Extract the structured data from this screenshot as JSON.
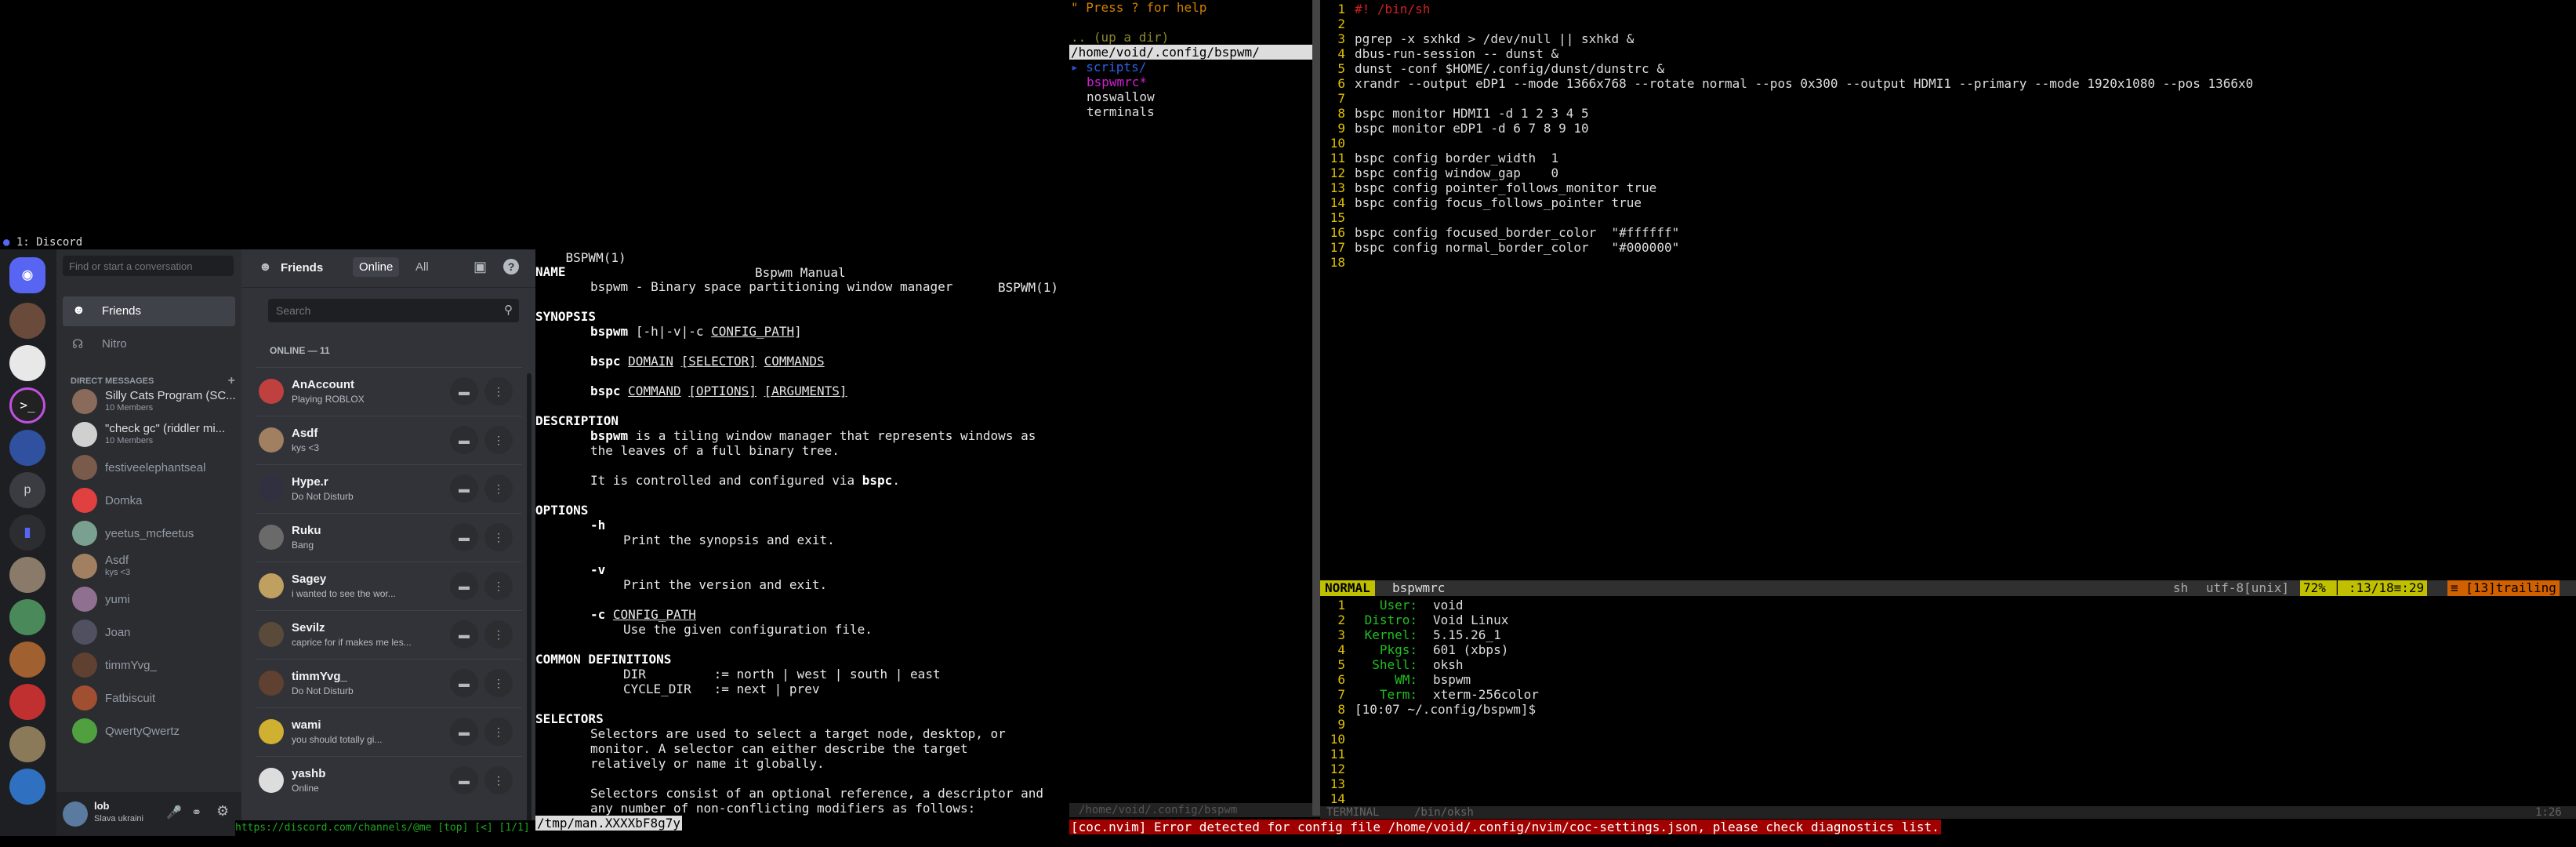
{
  "discord": {
    "titlebar": "1: Discord",
    "search_placeholder": "Find or start a conversation",
    "nav": {
      "friends": "Friends",
      "nitro": "Nitro"
    },
    "dm_header": "DIRECT MESSAGES",
    "dms": [
      {
        "name": "Silly Cats Program (SC...",
        "sub": "10 Members",
        "color": "#8a6a5a"
      },
      {
        "name": "\"check gc\" (riddler mi...",
        "sub": "10 Members",
        "color": "#d0d0d0"
      },
      {
        "name": "festiveelephantseal",
        "sub": "",
        "color": "#7a5a4a"
      },
      {
        "name": "Domka",
        "sub": "",
        "color": "#e04040"
      },
      {
        "name": "yeetus_mcfeetus",
        "sub": "",
        "color": "#7aa090"
      },
      {
        "name": "Asdf",
        "sub": "kys <3",
        "color": "#a08060"
      },
      {
        "name": "yumi",
        "sub": "",
        "color": "#907090"
      },
      {
        "name": "Joan",
        "sub": "",
        "color": "#505060"
      },
      {
        "name": "timmYvg_",
        "sub": "",
        "color": "#604030"
      },
      {
        "name": "Fatbiscuit",
        "sub": "",
        "color": "#a05030"
      },
      {
        "name": "QwertyQwertz",
        "sub": "",
        "color": "#50a040"
      }
    ],
    "user": {
      "name": "lob",
      "status": "Slava ukraini"
    },
    "friends_header": {
      "title": "Friends",
      "online": "Online",
      "all": "All"
    },
    "friends_search_placeholder": "Search",
    "online_count": "ONLINE — 11",
    "friends": [
      {
        "name": "AnAccount",
        "status": "Playing ROBLOX",
        "color": "#c04040"
      },
      {
        "name": "Asdf",
        "status": "kys <3",
        "color": "#a08060"
      },
      {
        "name": "Hype.r",
        "status": "Do Not Disturb",
        "color": "#303040"
      },
      {
        "name": "Ruku",
        "status": "Bang",
        "color": "#6a6a6a"
      },
      {
        "name": "Sagey",
        "status": "i wanted to see the wor...",
        "color": "#c0a060"
      },
      {
        "name": "Sevilz",
        "status": "caprice for if makes me les...",
        "color": "#5a4a3a"
      },
      {
        "name": "timmYvg_",
        "status": "Do Not Disturb",
        "color": "#604030"
      },
      {
        "name": "wami",
        "status": "you should totally gi...",
        "color": "#d0b030"
      },
      {
        "name": "yashb",
        "status": "Online",
        "color": "#dddddd"
      }
    ],
    "url": "https://discord.com/channels/@me [top] [<] [1/1]"
  },
  "man": {
    "header_left": "BSPWM(1)",
    "header_center": "Bspwm Manual",
    "header_right": "BSPWM(1)",
    "name_heading": "NAME",
    "name_text": "bspwm - Binary space partitioning window manager",
    "synopsis_heading": "SYNOPSIS",
    "syn1_cmd": "bspwm",
    "syn1_args": "[-h|-v|-c",
    "syn1_ul": "CONFIG_PATH",
    "syn1_end": "]",
    "syn2_cmd": "bspc",
    "syn2_a": "DOMAIN",
    "syn2_b": "[SELECTOR]",
    "syn2_c": "COMMANDS",
    "syn3_cmd": "bspc",
    "syn3_a": "COMMAND",
    "syn3_b": "[OPTIONS]",
    "syn3_c": "[ARGUMENTS]",
    "description_heading": "DESCRIPTION",
    "desc1_b": "bspwm",
    "desc1": " is a tiling window manager that represents windows as",
    "desc2": "the leaves of a full binary tree.",
    "desc3": "It is controlled and configured via ",
    "desc3_b": "bspc",
    "desc3_end": ".",
    "options_heading": "OPTIONS",
    "opt_h": "-h",
    "opt_h_desc": "Print the synopsis and exit.",
    "opt_v": "-v",
    "opt_v_desc": "Print the version and exit.",
    "opt_c": "-c",
    "opt_c_ul": "CONFIG_PATH",
    "opt_c_desc": "Use the given configuration file.",
    "common_heading": "COMMON DEFINITIONS",
    "def1": "DIR         := north | west | south | east",
    "def2": "CYCLE_DIR   := next | prev",
    "selectors_heading": "SELECTORS",
    "sel1": "Selectors are used to select a target node, desktop, or",
    "sel2": "monitor. A selector can either describe the target",
    "sel3": "relatively or name it globally.",
    "sel4": "Selectors consist of an optional reference, a descriptor and",
    "sel5": "any number of non-conflicting modifiers as follows:",
    "prompt": "/tmp/man.XXXXbF8g7y"
  },
  "nerdtree": {
    "help": "\" Press ? for help",
    "up": ".. (up a dir)",
    "path": "/home/void/.config/bspwm/",
    "items": [
      "scripts/",
      "bspwmrc*",
      "noswallow",
      "terminals"
    ],
    "status": "/home/void/.config/bspwm"
  },
  "nvim": {
    "lines": [
      "#! /bin/sh",
      "",
      "pgrep -x sxhkd > /dev/null || sxhkd &",
      "dbus-run-session -- dunst &",
      "dunst -conf $HOME/.config/dunst/dunstrc &",
      "xrandr --output eDP1 --mode 1366x768 --rotate normal --pos 0x300 --output HDMI1 --primary --mode 1920x1080 --pos 1366x0",
      "",
      "bspc monitor HDMI1 -d 1 2 3 4 5",
      "bspc monitor eDP1 -d 6 7 8 9 10",
      "",
      "bspc config border_width  1",
      "bspc config window_gap    0",
      "bspc config pointer_follows_monitor true",
      "bspc config focus_follows_pointer true",
      "",
      "bspc config focused_border_color  \"#ffffff\"",
      "bspc config normal_border_color   \"#000000\"",
      ""
    ],
    "status": {
      "mode": "NORMAL",
      "file": "bspwmrc",
      "filetype": "sh",
      "encoding": "utf-8[unix]",
      "percent": "72%",
      "position": ":13/18≡:29",
      "trailing": "[13]trailing"
    }
  },
  "terminal": {
    "fetch": [
      {
        "key": "User:",
        "val": "void"
      },
      {
        "key": "Distro:",
        "val": "Void Linux"
      },
      {
        "key": "Kernel:",
        "val": "5.15.26_1"
      },
      {
        "key": "Pkgs:",
        "val": "601 (xbps)"
      },
      {
        "key": "Shell:",
        "val": "oksh"
      },
      {
        "key": "WM:",
        "val": "bspwm"
      },
      {
        "key": "Term:",
        "val": "xterm-256color"
      }
    ],
    "prompt": "[10:07 ~/.config/bspwm]$",
    "status_left": "TERMINAL",
    "status_right": "/bin/oksh",
    "pos": "1:26"
  },
  "coc_error": "[coc.nvim] Error detected for config file /home/void/.config/nvim/coc-settings.json, please check diagnostics list."
}
